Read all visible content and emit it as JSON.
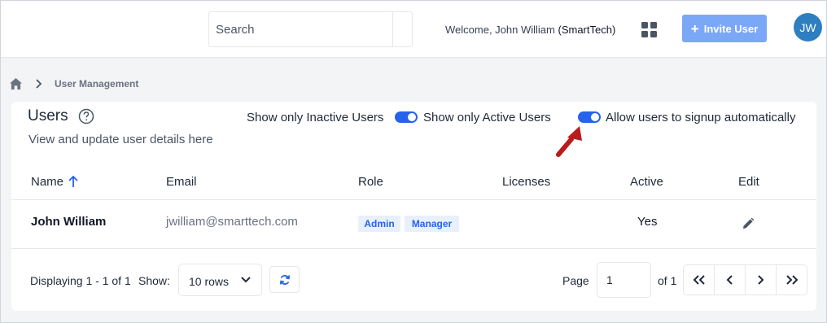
{
  "header": {
    "search_placeholder": "Search",
    "welcome_text": "Welcome, John William",
    "company": "(SmartTech)",
    "invite_label": "Invite User",
    "avatar_initials": "JW",
    "accent_color": "#7ba7f7"
  },
  "breadcrumb": {
    "current": "User Management"
  },
  "users_panel": {
    "title": "Users",
    "subtitle": "View and update user details here",
    "filters": {
      "inactive_label": "Show only Inactive Users",
      "active_label": "Show only Active Users",
      "active_toggle_on": true,
      "signup_label": "Allow users to signup automatically",
      "signup_toggle_on": true
    },
    "columns": [
      "Name",
      "Email",
      "Role",
      "Licenses",
      "Active",
      "Edit"
    ],
    "rows": [
      {
        "name": "John William",
        "email": "jwilliam@smarttech.com",
        "roles": [
          "Admin",
          "Manager"
        ],
        "licenses": "",
        "active": "Yes"
      }
    ]
  },
  "footer": {
    "displaying": "Displaying 1 - 1 of 1",
    "show_label": "Show:",
    "rows_option": "10 rows",
    "page_label": "Page",
    "page_value": "1",
    "of_label": "of 1"
  },
  "icons": {
    "home": "home-icon",
    "help": "question-circle-icon",
    "sort": "arrow-up-icon",
    "edit": "pencil-icon",
    "refresh": "refresh-icon",
    "apps": "grid-icon",
    "annotation": "red-arrow"
  }
}
